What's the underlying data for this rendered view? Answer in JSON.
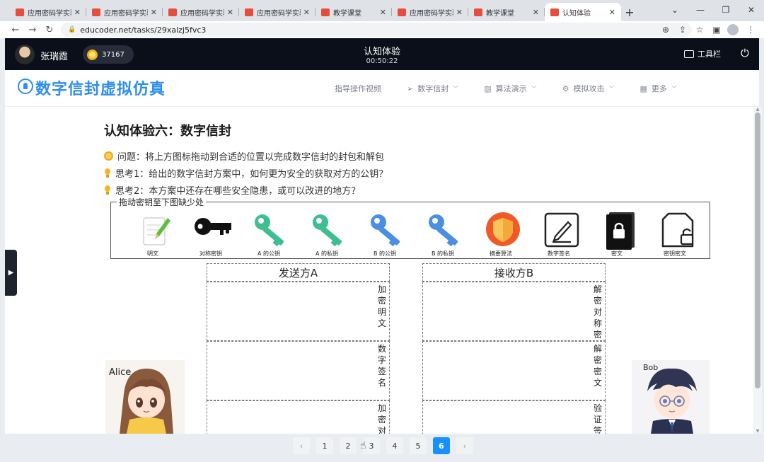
{
  "browser": {
    "tabs": [
      {
        "title": "应用密码学实验",
        "active": false
      },
      {
        "title": "应用密码学实验",
        "active": false
      },
      {
        "title": "应用密码学实验",
        "active": false
      },
      {
        "title": "应用密码学实验",
        "active": false
      },
      {
        "title": "教学课堂",
        "active": false
      },
      {
        "title": "应用密码学实验",
        "active": false
      },
      {
        "title": "教学课堂",
        "active": false
      },
      {
        "title": "认知体验",
        "active": true
      }
    ],
    "url": "educoder.net/tasks/29xalzj5fvc3"
  },
  "header": {
    "user_name": "张瑞霞",
    "coins": "37167",
    "title": "认知体验",
    "timer": "00:50:22",
    "toolbox_label": "工具栏"
  },
  "subnav": {
    "brand": "数字信封虚拟仿真",
    "items": [
      {
        "label": "指导操作视频",
        "icon": "",
        "has_dropdown": false
      },
      {
        "label": "数字信封",
        "icon": "send-icon",
        "has_dropdown": true
      },
      {
        "label": "算法演示",
        "icon": "image-icon",
        "has_dropdown": true
      },
      {
        "label": "模拟攻击",
        "icon": "settings-icon",
        "has_dropdown": true
      },
      {
        "label": "更多",
        "icon": "grid-icon",
        "has_dropdown": true
      }
    ]
  },
  "main": {
    "title": "认知体验六：数字信封",
    "question": "问题：将上方图标拖动到合适的位置以完成数字信封的封包和解包",
    "think1": "思考1：给出的数字信封方案中，如何更为安全的获取对方的公钥？",
    "think2": "思考2：本方案中还存在哪些安全隐患，或可以改进的地方？",
    "palette_legend": "拖动密钥至下图缺少处",
    "palette": [
      {
        "label": "明文",
        "icon": "document-icon"
      },
      {
        "label": "对称密钥",
        "icon": "black-key-icon",
        "color": "#111111"
      },
      {
        "label": "A 的公钥",
        "icon": "green-key-icon",
        "color": "#3fbf91"
      },
      {
        "label": "A 的私钥",
        "icon": "green-key-icon",
        "color": "#3fbf91"
      },
      {
        "label": "B 的公钥",
        "icon": "blue-key-icon",
        "color": "#4a8fe0"
      },
      {
        "label": "B 的私钥",
        "icon": "blue-key-icon",
        "color": "#4a8fe0"
      },
      {
        "label": "摘要算法",
        "icon": "shield-icon",
        "color": "#f05a28"
      },
      {
        "label": "数字签名",
        "icon": "signature-icon"
      },
      {
        "label": "密文",
        "icon": "locked-file-icon"
      },
      {
        "label": "密钥密文",
        "icon": "key-cipher-icon"
      }
    ],
    "sender": {
      "title": "发送方A",
      "slots": [
        "加密明文",
        "数字签名",
        "加密对"
      ]
    },
    "receiver": {
      "title": "接收方B",
      "slots": [
        "解密对称密",
        "解密密文",
        "验证签"
      ]
    },
    "alice_name": "Alice",
    "bob_name": "Bob"
  },
  "pagination": {
    "pages": [
      "1",
      "2",
      "3",
      "4",
      "5",
      "6"
    ],
    "current": "6"
  }
}
